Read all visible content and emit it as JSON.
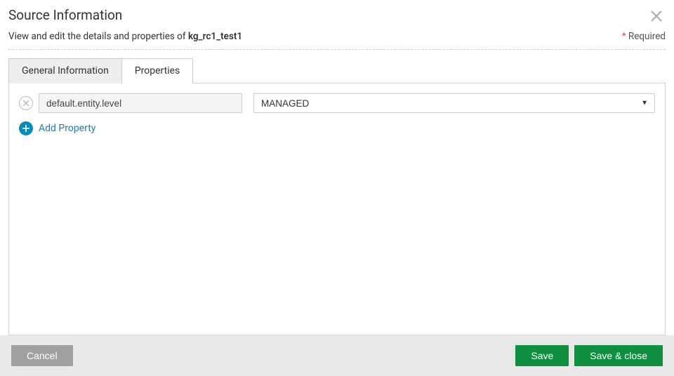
{
  "header": {
    "title": "Source Information",
    "subtitle_prefix": "View and edit the details and properties of ",
    "entity_name": "kg_rc1_test1",
    "required_label": "Required"
  },
  "tabs": {
    "general": "General Information",
    "properties": "Properties",
    "active": "properties"
  },
  "properties": {
    "rows": [
      {
        "name": "default.entity.level",
        "value": "MANAGED"
      }
    ],
    "add_label": "Add Property"
  },
  "footer": {
    "cancel": "Cancel",
    "save": "Save",
    "save_close": "Save & close"
  }
}
